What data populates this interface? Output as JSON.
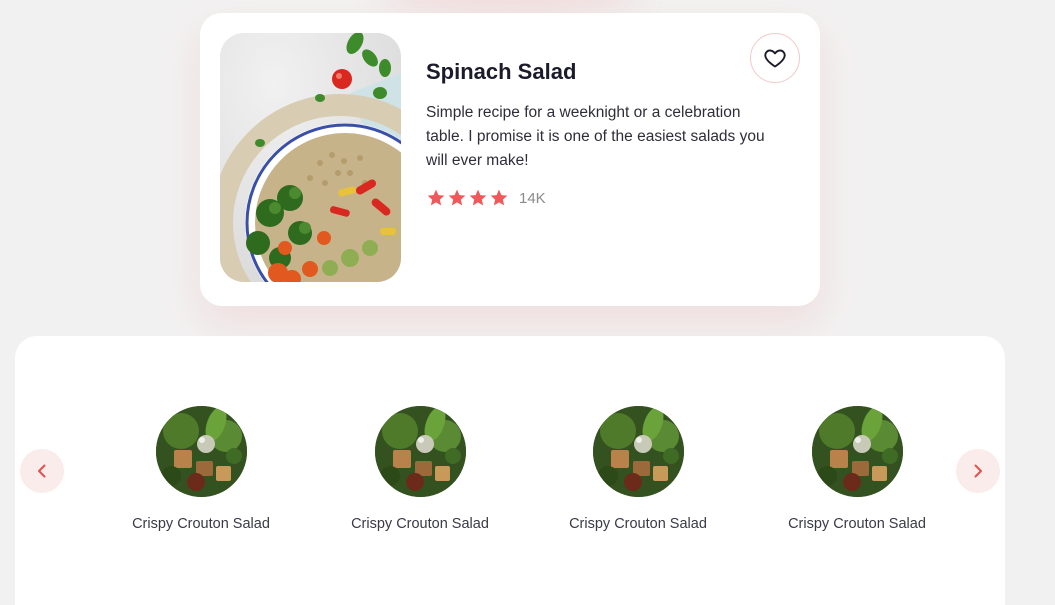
{
  "featured": {
    "title": "Spinach Salad",
    "description": "Simple recipe for a weeknight or a celebration table. I promise it is one of the easiest salads you will ever make!",
    "rating_stars": 4,
    "rating_count": "14K",
    "favorite_icon": "heart-icon",
    "image": "salad-bowl-image"
  },
  "carousel": {
    "prev_icon": "chevron-left-icon",
    "next_icon": "chevron-right-icon",
    "items": [
      {
        "label": "Crispy Crouton Salad",
        "image": "crouton-salad-image"
      },
      {
        "label": "Crispy Crouton Salad",
        "image": "crouton-salad-image"
      },
      {
        "label": "Crispy Crouton Salad",
        "image": "crouton-salad-image"
      },
      {
        "label": "Crispy Crouton Salad",
        "image": "crouton-salad-image"
      }
    ]
  },
  "colors": {
    "accent": "#f0585a",
    "background": "#f2f1f1",
    "card": "#ffffff"
  }
}
